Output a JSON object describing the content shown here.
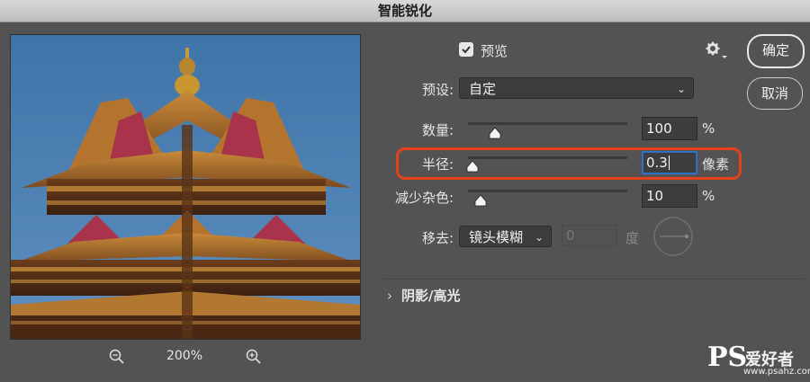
{
  "window": {
    "title": "智能锐化"
  },
  "preview": {
    "checkbox_label": "预览",
    "checked": true,
    "zoom_level": "200%"
  },
  "buttons": {
    "ok": "确定",
    "cancel": "取消"
  },
  "preset": {
    "label": "预设:",
    "value": "自定"
  },
  "amount": {
    "label": "数量:",
    "value": "100",
    "unit": "%",
    "slider_fraction": 0.17
  },
  "radius": {
    "label": "半径:",
    "value": "0.3",
    "unit": "像素",
    "slider_fraction": 0.03
  },
  "reduce_noise": {
    "label": "减少杂色:",
    "value": "10",
    "unit": "%",
    "slider_fraction": 0.08
  },
  "remove": {
    "label": "移去:",
    "value": "镜头模糊",
    "angle_value": "0",
    "angle_unit": "度"
  },
  "shadows_highlights": {
    "label": "阴影/高光"
  },
  "watermark": {
    "main": "PS",
    "side": "爱好者",
    "url": "www.psahz.com"
  },
  "colors": {
    "highlight": "#e5421c",
    "focus": "#2f71c9",
    "panel": "#535353"
  }
}
